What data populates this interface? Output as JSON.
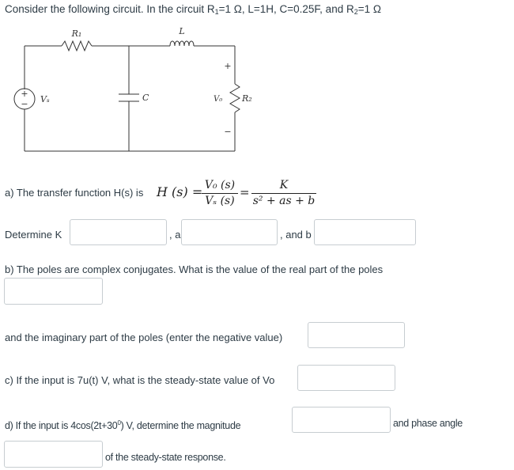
{
  "header": {
    "intro": "Consider the following circuit. In the circuit R",
    "r1_sub": "1",
    "r1_val": "=1 Ω, L=1H, C=0.25F, and R",
    "r2_sub": "2",
    "r2_val": "=1 Ω"
  },
  "circuit": {
    "labels": {
      "r1": "R₁",
      "l": "L",
      "c": "C",
      "vs": "Vₛ",
      "vo": "V₀",
      "r2": "R₂",
      "plus": "+",
      "minus": "−",
      "src_plus": "+",
      "src_minus": "−"
    },
    "components": [
      "voltage-source",
      "resistor-r1",
      "capacitor-c",
      "inductor-l",
      "resistor-r2"
    ]
  },
  "part_a": {
    "prompt": "a) The transfer function H(s) is",
    "lhs": "H (s) =",
    "frac1_num": "V₀ (s)",
    "frac1_den": "Vₛ (s)",
    "equals": "=",
    "frac2_num": "K",
    "frac2_den": "s² + as + b",
    "determine_label": "Determine K",
    "a_label": ", a",
    "b_label": ", and b",
    "k_value": "",
    "a_value": "",
    "b_value": ""
  },
  "part_b": {
    "prompt": "b) The poles are complex conjugates. What is the value of the real part of the poles",
    "real_value": "",
    "imag_label": "and the imaginary part of the poles (enter the negative value)",
    "imag_value": ""
  },
  "part_c": {
    "prompt": "c) If the input is 7u(t) V, what is the steady-state value of Vo",
    "vo_value": ""
  },
  "part_d": {
    "prompt_pre": "d) If the input is 4cos(2t+30",
    "prompt_sup": "0",
    "prompt_post": ") V,  determine the magnitude",
    "magnitude_value": "",
    "phase_label": "and phase angle",
    "phase_value": "",
    "suffix": "of the steady-state response."
  }
}
